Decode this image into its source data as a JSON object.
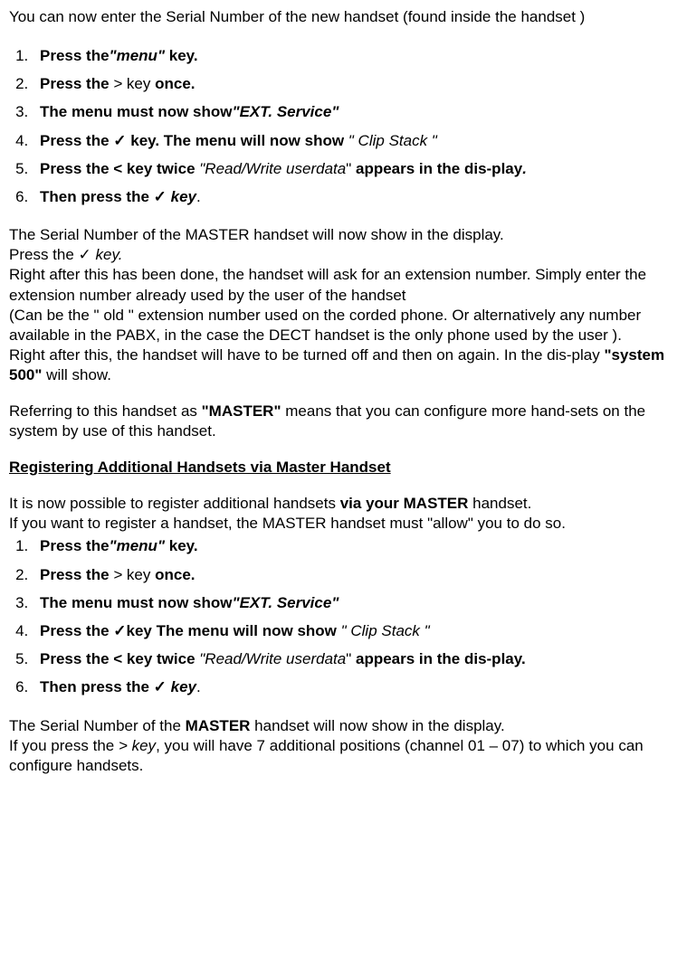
{
  "intro": "You can now enter the Serial Number of the new handset (found inside the handset )",
  "list1": {
    "i1": {
      "a": "Press the",
      "b": "\"menu\" ",
      "c": "key."
    },
    "i2": {
      "a": "Press the ",
      "b": ">",
      "c": " key ",
      "d": "once."
    },
    "i3": {
      "a": "The menu must now show",
      "b": "\"EXT. Service\""
    },
    "i4": {
      "a": "Press the ",
      "b": "✓",
      "c": " key. The menu will now show ",
      "d": "\" Clip Stack \""
    },
    "i5": {
      "a": "Press the ",
      "b": "<",
      "c": " key twice ",
      "d": "\"Read/Write userdata",
      "e": "\" ",
      "f": "appears  in the dis-play",
      "g": "."
    },
    "i6": {
      "a": "Then press the ",
      "b": "✓",
      "c": " key",
      "d": "."
    }
  },
  "para1": {
    "l1a": "The Serial Number of the MASTER handset will now show in the display.",
    "l2a": "Press the ",
    "l2b": "✓",
    "l2c": " key.",
    "l3": "Right after this has been done, the handset will ask for an extension number. Simply enter the extension number already used by the user of the handset",
    "l4": "(Can be the \" old \" extension number used on the corded phone. Or alternatively any number available in the PABX, in the case the DECT handset is the only phone used by the user ).",
    "l5a": " Right after this, the handset will  have to be turned off and then on again. In the dis-play ",
    "l5b": "\"system 500\"",
    "l5c": " will show."
  },
  "para2": {
    "a": "Referring to this handset as ",
    "b": "\"MASTER\"",
    "c": " means that you can configure more hand-sets on the system by use of this handset."
  },
  "heading": "Registering Additional Handsets via Master Handset",
  "para3": {
    "l1a": "It is now possible to register additional handsets ",
    "l1b": "via your MASTER",
    "l1c": " handset.",
    "l2": "If you want to register a handset, the MASTER handset must \"allow\" you to do so."
  },
  "list2": {
    "i1": {
      "a": "Press the",
      "b": "\"menu\" ",
      "c": "key."
    },
    "i2": {
      "a": "Press the ",
      "b": ">",
      "c": " key ",
      "d": "once."
    },
    "i3": {
      "a": "The menu must now show",
      "b": "\"EXT. Service\""
    },
    "i4": {
      "a": "Press the ",
      "b": "✓",
      "c": "key The menu will now show ",
      "d": "\" Clip Stack \""
    },
    "i5": {
      "a": "Press the ",
      "b": "<",
      "c": " key twice ",
      "d": "\"Read/Write userdata",
      "e": "\" ",
      "f": "appears  in the dis-play."
    },
    "i6": {
      "a": "Then press the ",
      "b": "✓",
      "c": " key",
      "d": "."
    }
  },
  "para4": {
    "l1a": "The Serial Number of the ",
    "l1b": "MASTER",
    "l1c": " handset will now show in the display.",
    "l2a": "If you press the ",
    "l2b": "> key",
    "l2c": ", you will have 7 additional positions  (channel 01 – 07) to which you can configure handsets."
  }
}
